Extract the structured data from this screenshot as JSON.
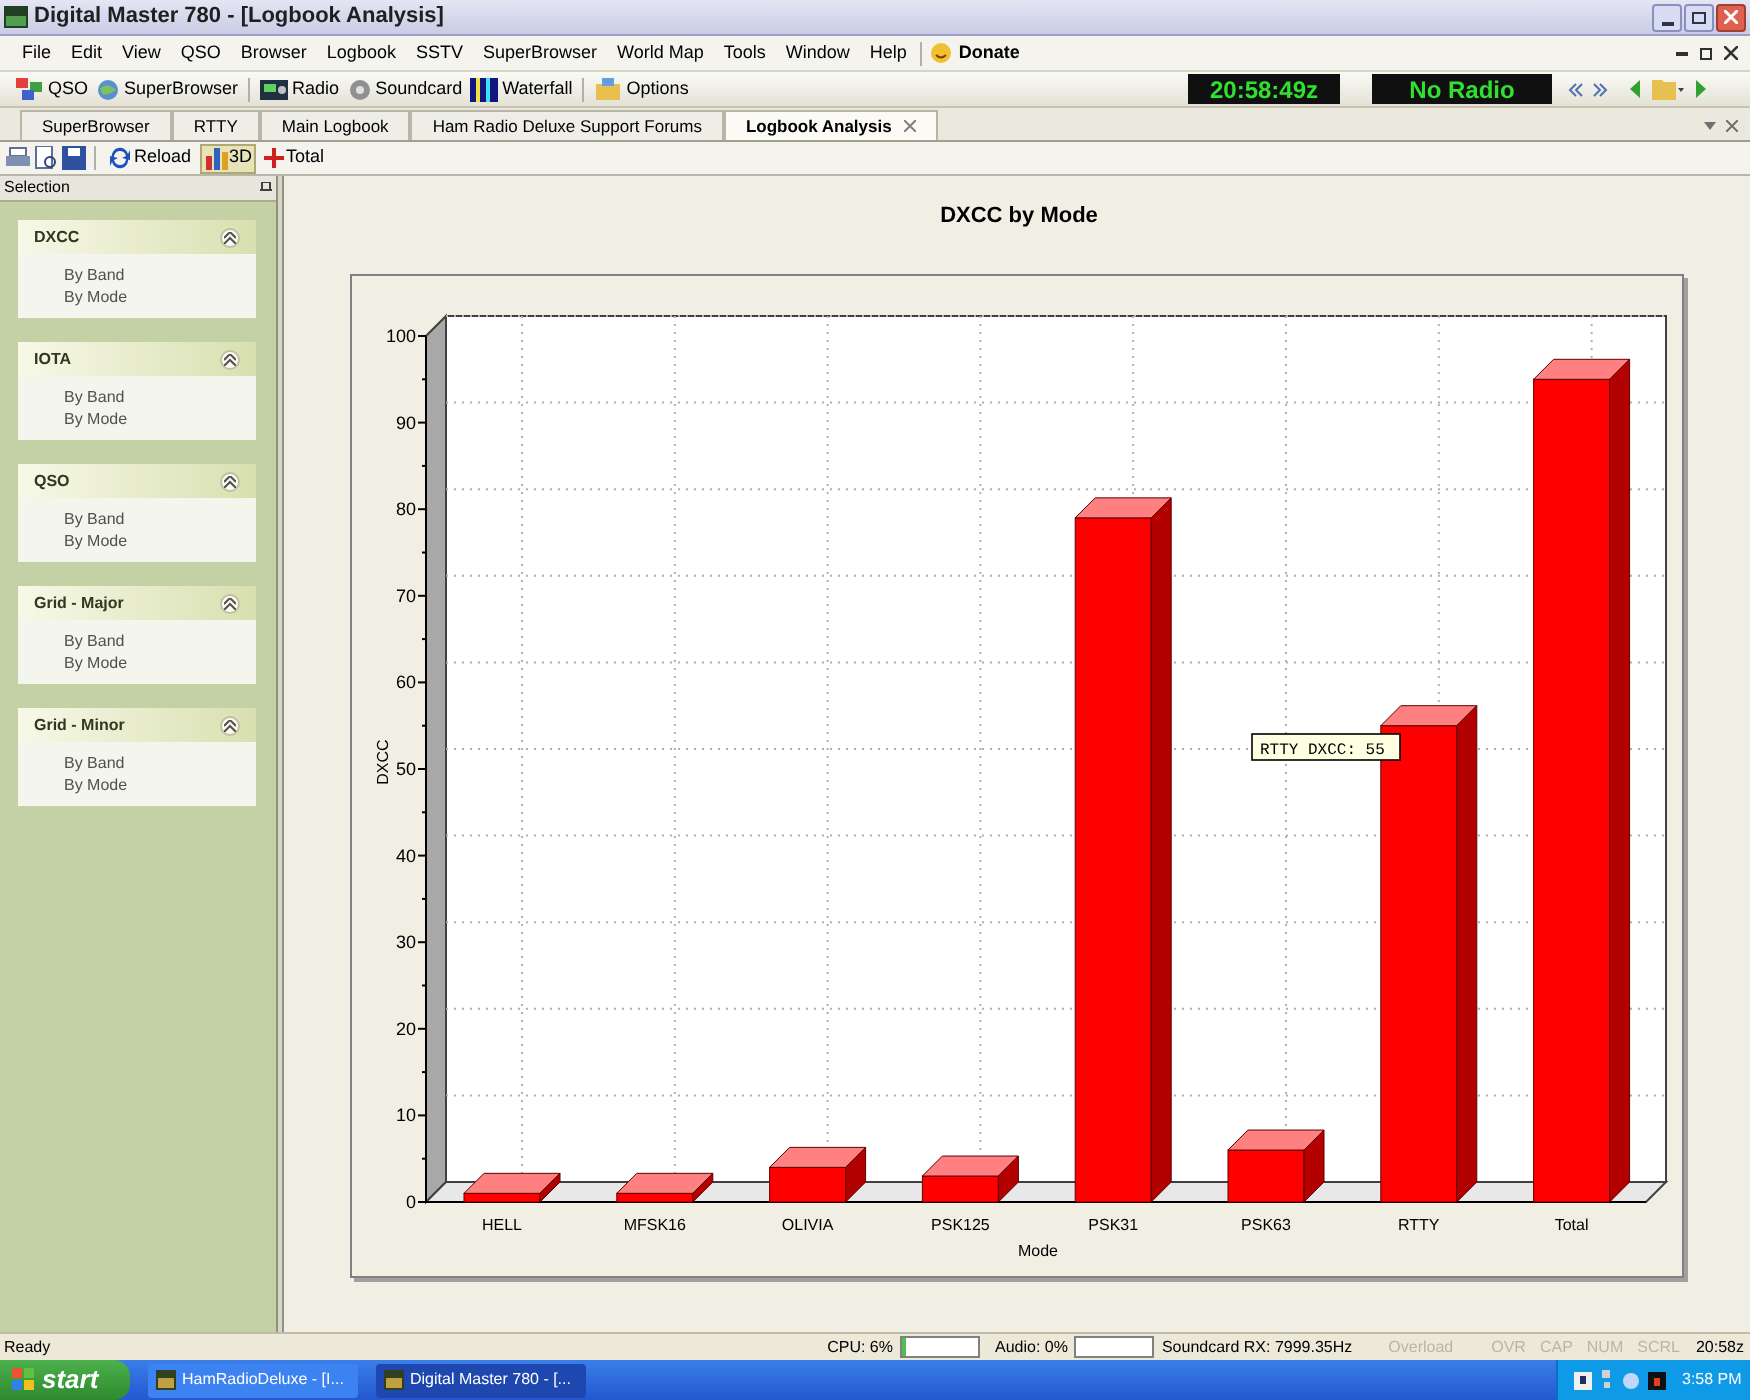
{
  "window": {
    "title": "Digital Master 780 - [Logbook Analysis]"
  },
  "menu": [
    "File",
    "Edit",
    "View",
    "QSO",
    "Browser",
    "Logbook",
    "SSTV",
    "SuperBrowser",
    "World Map",
    "Tools",
    "Window",
    "Help"
  ],
  "donate": "Donate",
  "toolbar": [
    {
      "label": "QSO",
      "kind": "squares"
    },
    {
      "label": "SuperBrowser",
      "kind": "globe"
    },
    {
      "label": "Radio",
      "kind": "radio"
    },
    {
      "label": "Soundcard",
      "kind": "disc"
    },
    {
      "label": "Waterfall",
      "kind": "waterfall"
    },
    {
      "label": "Options",
      "kind": "options"
    }
  ],
  "clock": "20:58:49z",
  "radio": "No Radio",
  "tabs": [
    {
      "label": "SuperBrowser",
      "selected": false
    },
    {
      "label": "RTTY",
      "selected": false
    },
    {
      "label": "Main Logbook",
      "selected": false
    },
    {
      "label": "Ham Radio Deluxe Support Forums",
      "selected": false
    },
    {
      "label": "Logbook Analysis",
      "selected": true
    }
  ],
  "analysis_toolbar": [
    {
      "label": "Reload",
      "kind": "reload",
      "selected": false
    },
    {
      "label": "3D",
      "kind": "chart",
      "selected": true
    },
    {
      "label": "Total",
      "kind": "plus",
      "selected": false
    }
  ],
  "sidebar": {
    "title": "Selection",
    "groups": [
      {
        "title": "DXCC",
        "expanded": true,
        "items": [
          "By Band",
          "By Mode"
        ]
      },
      {
        "title": "IOTA",
        "expanded": true,
        "items": [
          "By Band",
          "By Mode"
        ]
      },
      {
        "title": "QSO",
        "expanded": true,
        "items": [
          "By Band",
          "By Mode"
        ]
      },
      {
        "title": "Grid - Major",
        "expanded": true,
        "items": [
          "By Band",
          "By Mode"
        ]
      },
      {
        "title": "Grid - Minor",
        "expanded": true,
        "items": [
          "By Band",
          "By Mode"
        ]
      }
    ]
  },
  "chart_data": {
    "type": "bar",
    "title": "DXCC by Mode",
    "xlabel": "Mode",
    "ylabel": "DXCC",
    "categories": [
      "HELL",
      "MFSK16",
      "OLIVIA",
      "PSK125",
      "PSK31",
      "PSK63",
      "RTTY",
      "Total"
    ],
    "series": [
      {
        "color": "#ff0000",
        "values": [
          1,
          1,
          4,
          3,
          79,
          6,
          55,
          95
        ]
      }
    ],
    "ylim": [
      0,
      100
    ],
    "yticks": [
      0,
      10,
      20,
      30,
      40,
      50,
      60,
      70,
      80,
      90,
      100
    ],
    "annotations": [
      "RTTY DXCC: 55"
    ]
  },
  "status_bar": {
    "text": "Ready",
    "cpu": {
      "label": "CPU: 6%",
      "level": 0.06
    },
    "audio": {
      "label": "Audio: 0%",
      "level": 0
    },
    "soundcard": "Soundcard RX: 7999.35Hz",
    "indicators": [
      {
        "label": "Overload",
        "disabled": true
      },
      {
        "label": "OVR",
        "disabled": true
      },
      {
        "label": "CAP",
        "disabled": true
      },
      {
        "label": "NUM",
        "disabled": true
      },
      {
        "label": "SCRL",
        "disabled": true
      }
    ],
    "time": "20:58z"
  },
  "taskbar": {
    "start": "start",
    "tasks": [
      {
        "label": "HamRadioDeluxe - [I...",
        "selected": false
      },
      {
        "label": "Digital Master 780 - [...",
        "selected": true
      }
    ],
    "clock": "3:58 PM"
  }
}
